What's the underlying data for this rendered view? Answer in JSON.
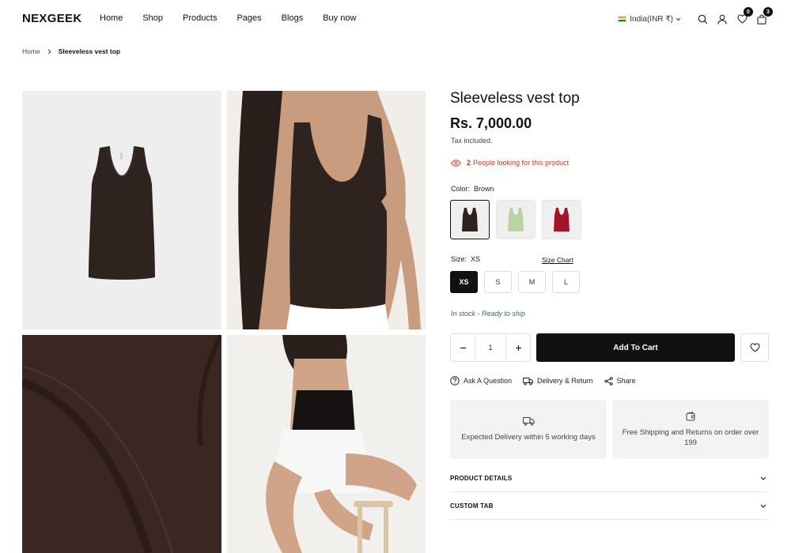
{
  "header": {
    "logo": "NEXGEEK",
    "nav": [
      "Home",
      "Shop",
      "Products",
      "Pages",
      "Blogs",
      "Buy now"
    ],
    "currency": "India(INR ₹)",
    "wishlist_count": "0",
    "cart_count": "3"
  },
  "breadcrumb": {
    "home": "Home",
    "current": "Sleeveless vest top"
  },
  "product": {
    "title": "Sleeveless vest top",
    "price": "Rs. 7,000.00",
    "tax_note": "Tax included.",
    "viewers_count": "2",
    "viewers_text": "People looking for this product",
    "color_label": "Color:",
    "color_value": "Brown",
    "swatches": [
      {
        "name": "Brown",
        "color": "#2f2320"
      },
      {
        "name": "Green",
        "color": "#b9d4a2"
      },
      {
        "name": "Red",
        "color": "#a3162a"
      }
    ],
    "size_label": "Size:",
    "size_value": "XS",
    "size_chart": "Size Chart",
    "sizes": [
      "XS",
      "S",
      "M",
      "L"
    ],
    "stock_status": "In stock - Ready to ship",
    "quantity": "1",
    "add_to_cart": "Add To Cart",
    "actions": [
      "Ask A Question",
      "Delivery & Return",
      "Share"
    ],
    "info_boxes": [
      "Expected Delivery within 5 working days",
      "Free Shipping and Returns on order over 199"
    ],
    "accordions": [
      "PRODUCT DETAILS",
      "CUSTOM TAB"
    ]
  },
  "colors": {
    "accent": "#111111",
    "viewers_red": "#c0392b",
    "stock_green": "#2e7d32"
  }
}
